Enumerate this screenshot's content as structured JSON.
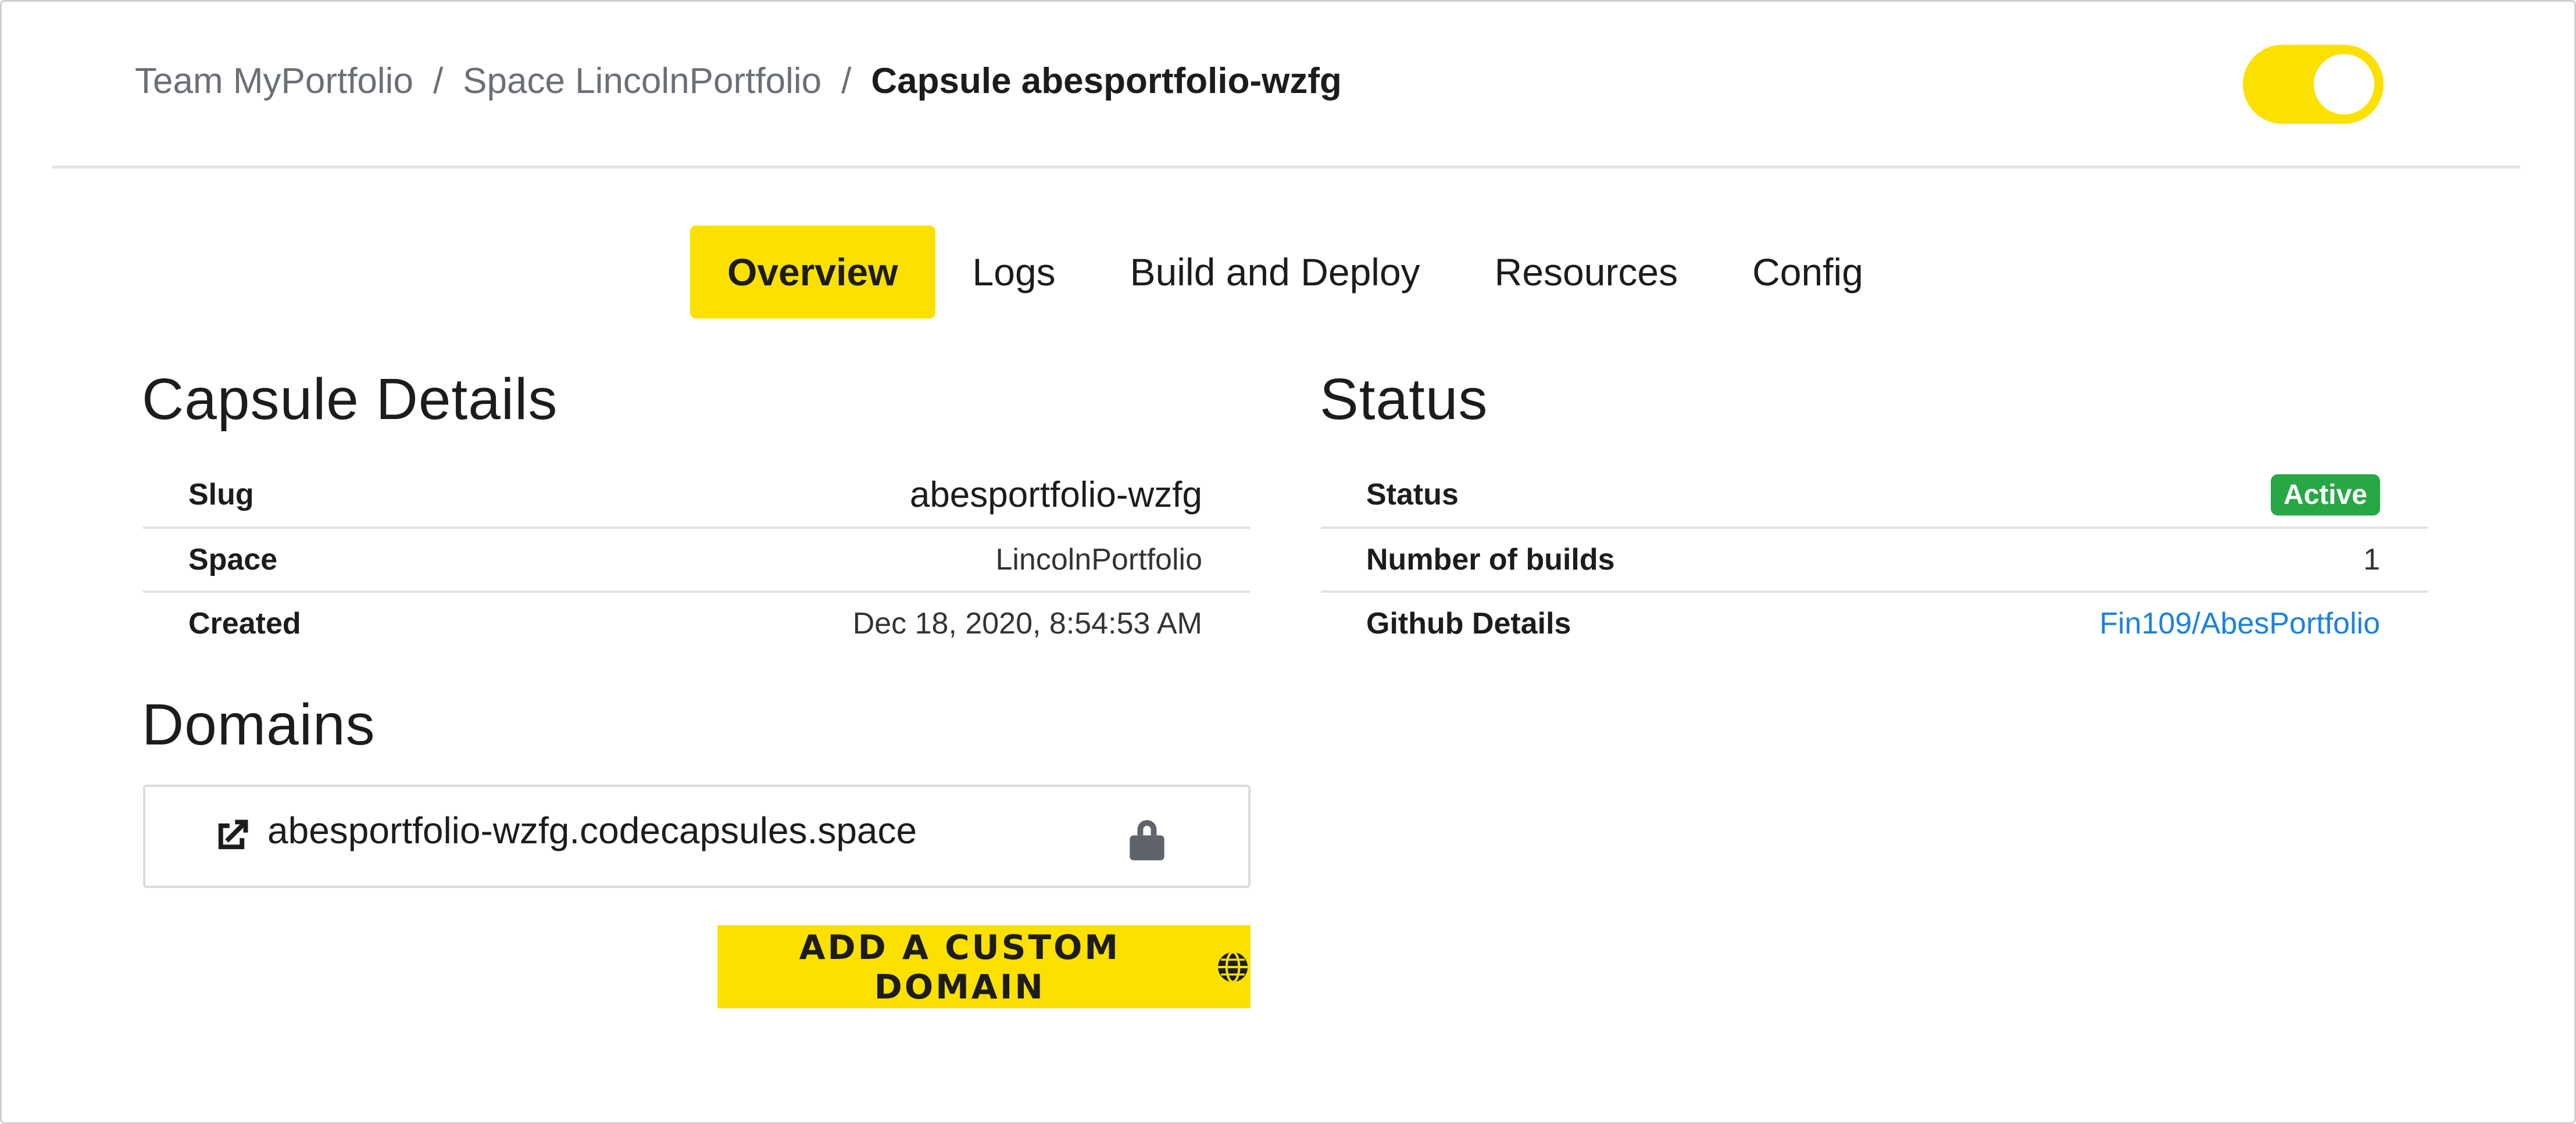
{
  "breadcrumb": {
    "team": "Team MyPortfolio",
    "space": "Space LincolnPortfolio",
    "capsule": "Capsule abesportfolio-wzfg",
    "separator": "/"
  },
  "theme_toggle": {
    "state": "on",
    "color": "#fbe000"
  },
  "tabs": [
    {
      "label": "Overview",
      "active": true
    },
    {
      "label": "Logs",
      "active": false
    },
    {
      "label": "Build and Deploy",
      "active": false
    },
    {
      "label": "Resources",
      "active": false
    },
    {
      "label": "Config",
      "active": false
    }
  ],
  "capsule_details": {
    "title": "Capsule Details",
    "rows": [
      {
        "label": "Slug",
        "value": "abesportfolio-wzfg"
      },
      {
        "label": "Space",
        "value": "LincolnPortfolio"
      },
      {
        "label": "Created",
        "value": "Dec 18, 2020, 8:54:53 AM"
      }
    ]
  },
  "status": {
    "title": "Status",
    "rows": [
      {
        "label": "Status",
        "value": "Active"
      },
      {
        "label": "Number of builds",
        "value": "1"
      },
      {
        "label": "Github Details",
        "value": "Fin109/AbesPortfolio"
      }
    ]
  },
  "domains": {
    "title": "Domains",
    "items": [
      {
        "domain": "abesportfolio-wzfg.codecapsules.space",
        "icon": "external-link-icon",
        "secure_icon": "lock-icon"
      }
    ],
    "add_button_label": "ADD A CUSTOM DOMAIN",
    "add_button_icon": "globe-icon"
  },
  "colors": {
    "accent": "#fbe000",
    "active_badge": "#28a745",
    "link": "#1a82e2"
  }
}
